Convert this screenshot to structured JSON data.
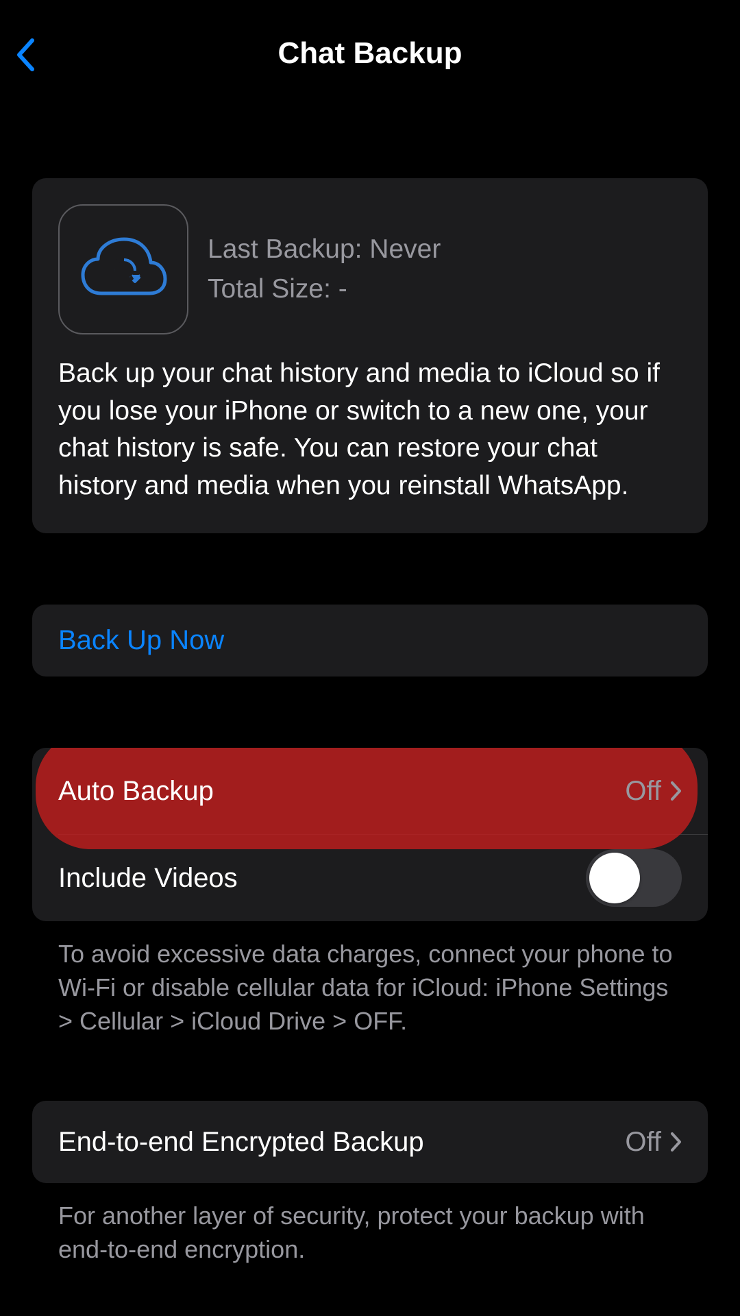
{
  "header": {
    "title": "Chat Backup"
  },
  "info_card": {
    "last_backup_label": "Last Backup: Never",
    "total_size_label": "Total Size: -",
    "description": "Back up your chat history and media to iCloud so if you lose your iPhone or switch to a new one, your chat history is safe. You can restore your chat history and media when you reinstall WhatsApp."
  },
  "actions": {
    "backup_now": "Back Up Now"
  },
  "settings": {
    "auto_backup_label": "Auto Backup",
    "auto_backup_value": "Off",
    "include_videos_label": "Include Videos",
    "include_videos_on": false,
    "footer_note": "To avoid excessive data charges, connect your phone to Wi-Fi or disable cellular data for iCloud: iPhone Settings > Cellular > iCloud Drive > OFF."
  },
  "encryption": {
    "label": "End-to-end Encrypted Backup",
    "value": "Off",
    "footer_note": "For another layer of security, protect your backup with end-to-end encryption."
  }
}
